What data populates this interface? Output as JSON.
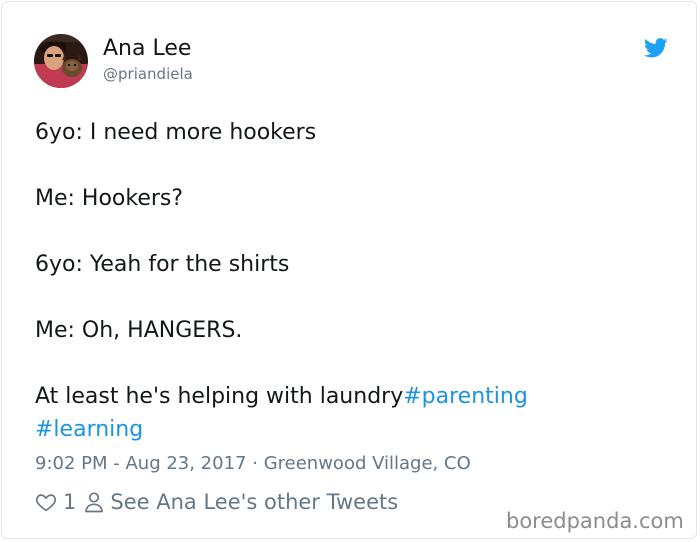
{
  "author": {
    "name": "Ana Lee",
    "handle": "@priandiela"
  },
  "tweet": {
    "lines": [
      "6yo: I need more hookers",
      "Me: Hookers?",
      "6yo: Yeah for the shirts",
      "Me: Oh, HANGERS.",
      "At least he's helping with laundry"
    ],
    "hashtags": [
      "#parenting",
      "#learning"
    ]
  },
  "meta": {
    "time": "9:02 PM - Aug 23, 2017",
    "separator": "·",
    "location": "Greenwood Village, CO"
  },
  "actions": {
    "like_count": "1",
    "other_tweets_label": "See Ana Lee's other Tweets"
  },
  "watermark": "boredpanda.com",
  "colors": {
    "brand_blue": "#1da1f2",
    "hashtag_blue": "#1b95e0",
    "secondary_text": "#657786",
    "border": "#e1e8ed"
  },
  "icons": {
    "bird": "twitter-bird-icon",
    "like": "heart-icon",
    "profile": "person-icon"
  }
}
